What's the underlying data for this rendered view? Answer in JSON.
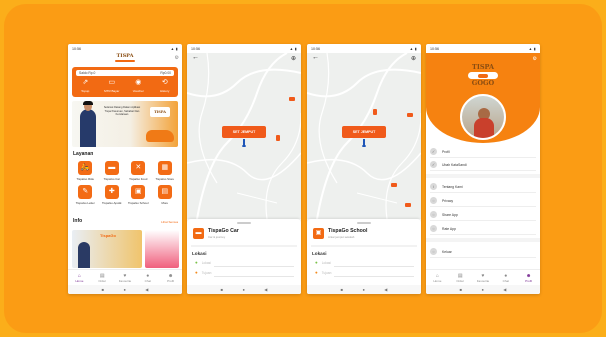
{
  "status_bar": {
    "p1_time": "10:56",
    "p2_time": "10:56",
    "p3_time": "10:56",
    "p4_time": "10:56"
  },
  "home": {
    "logo": "TISPA",
    "wallet_left": "Saldo Rp.0",
    "wallet_right": "Rp0.00",
    "wallet_actions": [
      {
        "label": "Topup",
        "icon": "external-link-icon"
      },
      {
        "label": "MTR Bayar",
        "icon": "money-icon"
      },
      {
        "label": "Voucher",
        "icon": "voucher-icon"
      },
      {
        "label": "History",
        "icon": "history-icon"
      }
    ],
    "banner_text": "Selamat Datang Dalam Aplikasi Tispa Pasuruan, Sahabat Dan Kendaraan",
    "banner_logo": "TISPA",
    "section_layanan": "Layanan",
    "services": [
      {
        "label": "TispaGo Ride",
        "icon": "motorbike-icon"
      },
      {
        "label": "TispaGo Car",
        "icon": "car-icon"
      },
      {
        "label": "TispaGo Food",
        "icon": "food-icon"
      },
      {
        "label": "TispaGo Store",
        "icon": "store-icon"
      },
      {
        "label": "TispaGo Letter",
        "icon": "letter-icon"
      },
      {
        "label": "TispaGo Apotik",
        "icon": "apotik-icon"
      },
      {
        "label": "TispaGo School",
        "icon": "school-icon"
      },
      {
        "label": "More",
        "icon": "more-icon"
      }
    ],
    "section_info": "Info",
    "see_all": "Lihat Semua",
    "info_card_text": "TispaGo"
  },
  "tabbar": [
    {
      "label": "Home",
      "icon": "home-icon"
    },
    {
      "label": "Order",
      "icon": "order-icon"
    },
    {
      "label": "Favourite",
      "icon": "favourite-icon"
    },
    {
      "label": "Chat",
      "icon": "chat-icon"
    },
    {
      "label": "Profil",
      "icon": "profile-icon"
    }
  ],
  "car_screen": {
    "pickup_button": "SET JEMPUT",
    "service_name": "TispaGo Car",
    "service_sub": "Car & journey",
    "lokasi": "Lokasi",
    "origin": "Lokasi",
    "destination": "Tujuan"
  },
  "school_screen": {
    "pickup_button": "SET JEMPUT",
    "service_name": "TispaGo School",
    "service_sub": "Antar jemput sekolah",
    "lokasi": "Lokasi",
    "origin": "Lokasi",
    "destination": "Tujuan"
  },
  "profile": {
    "logo_top": "TISPA",
    "logo_bottom": "GOGO",
    "menu": [
      {
        "label": "Profil",
        "icon": "user-icon"
      },
      {
        "label": "Ubah KataSandi",
        "icon": "lock-icon"
      },
      {
        "label": "Tentang Kami",
        "icon": "info-icon"
      },
      {
        "label": "Privacy",
        "icon": "shield-icon"
      },
      {
        "label": "Share App",
        "icon": "share-icon"
      },
      {
        "label": "Rate App",
        "icon": "star-icon"
      },
      {
        "label": "Keluar",
        "icon": "logout-icon"
      }
    ]
  },
  "colors": {
    "background": "#fbae1a",
    "frame": "#fb9c14",
    "accent": "#f26a13",
    "active_tab": "#7a2e93"
  }
}
